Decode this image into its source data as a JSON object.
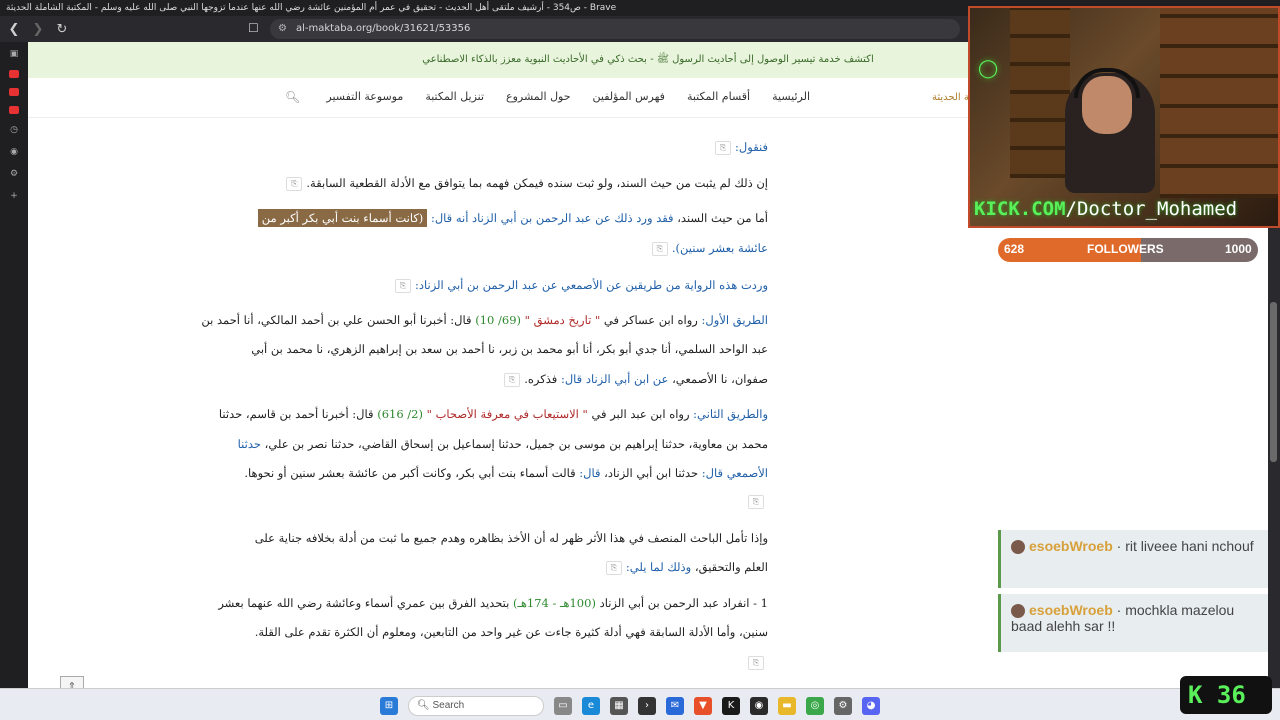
{
  "browser": {
    "title": "ص354 - أرشيف ملتقى أهل الحديث - تحقيق في عمر أم المؤمنين عائشة رضي الله عنها عندما تزوجها النبي صلى الله عليه وسلم - المكتبة الشاملة الحديثة - Brave",
    "url": "al-maktaba.org/book/31621/53356"
  },
  "banner": {
    "text": "اكتشف خدمة تيسير الوصول إلى أحاديث الرسول ﷺ - بحث ذكي في الأحاديث النبوية معزز بالذكاء الاصطناعي"
  },
  "menu": {
    "brand": "المكتبة الحديثة",
    "items": [
      "الرئيسية",
      "أقسام المكتبة",
      "فهرس المؤلفين",
      "حول المشروع",
      "تنزيل المكتبة",
      "موسوعة التفسير"
    ]
  },
  "content": {
    "l1": "فنقول:",
    "l2": "إن ذلك لم يثبت من حيث السند، ولو ثبت سنده فيمكن فهمه بما يتوافق مع الأدلة القطعية السابقة.",
    "l3a": "أما من حيث السند، ",
    "l3b": "فقد ورد ذلك عن عبد الرحمن بن أبي الزناد أنه قال: ",
    "l3c": "(كانت أسماء بنت أبي بكر أكبر من",
    "l4": "عائشة بعشر سنين).",
    "l5": "وردت هذه الرواية من طريقين عن الأصمعي عن عبد الرحمن بن أبي الزناد:",
    "l6a": "الطريق الأول: ",
    "l6b": "رواه ابن عساكر في ",
    "l6c": "\" تاريخ دمشق \"",
    "l6d": " (69/ 10)",
    "l6e": " قال: أخبرنا أبو الحسن علي بن أحمد المالكي، أنا أحمد بن",
    "l7": "عبد الواحد السلمي، أنا جدي أبو بكر، أنا أبو محمد بن زبر، نا أحمد بن سعد بن إبراهيم الزهري، نا محمد بن أبي",
    "l8a": "صفوان، نا الأصمعي، ",
    "l8b": "عن ابن أبي الزناد قال:",
    "l8c": " فذكره.",
    "l9a": "والطريق الثاني: ",
    "l9b": "رواه ابن عبد البر في ",
    "l9c": "\" الاستيعاب في معرفة الأصحاب \"",
    "l9d": " (2/ 616)",
    "l9e": " قال: أخبرنا أحمد بن قاسم، حدثنا",
    "l10a": "محمد بن معاوية، حدثنا إبراهيم بن موسى بن جميل، حدثنا إسماعيل بن إسحاق القاضي، حدثنا نصر بن علي، ",
    "l10b": "حدثنا",
    "l11a": "الأصمعي قال: ",
    "l11b": "حدثنا ابن أبي الزناد، ",
    "l11c": "قال: ",
    "l11d": "قالت أسماء بنت أبي بكر، وكانت أكبر من عائشة بعشر سنين أو نحوها.",
    "l12": "وإذا تأمل الباحث المنصف في هذا الأثر ظهر له أن الأخذ بظاهره وهدم جميع ما ثبت من أدلة بخلافه جناية على",
    "l13a": "العلم والتحقيق، ",
    "l13b": "وذلك لما يلي:",
    "l14a": "1 - انفراد عبد الرحمن بن أبي الزناد ",
    "l14b": "(100هـ - 174هـ)",
    "l14c": " بتحديد الفرق بين عمري أسماء وعائشة رضي الله عنهما بعشر",
    "l15": "سنين، وأما الأدلة السابقة فهي أدلة كثيرة جاءت عن غير واحد من التابعين، ومعلوم أن الكثرة تقدم على القلة."
  },
  "stream": {
    "overlay": "KICK.COM/Doctor_Mohamed",
    "overlay_site": "KICK.COM",
    "overlay_user": "/Doctor_Mohamed",
    "followers_current": "628",
    "followers_label": "FOLLOWERS",
    "followers_goal": "1000",
    "chat": [
      {
        "user": "esoebWroeb",
        "message": "rit liveee hani nchouf"
      },
      {
        "user": "esoebWroeb",
        "message": "mochkla mazelou baad alehh sar !!"
      }
    ],
    "viewer_count": "36",
    "kick_icon": "K"
  },
  "taskbar": {
    "search_label": "Search"
  }
}
